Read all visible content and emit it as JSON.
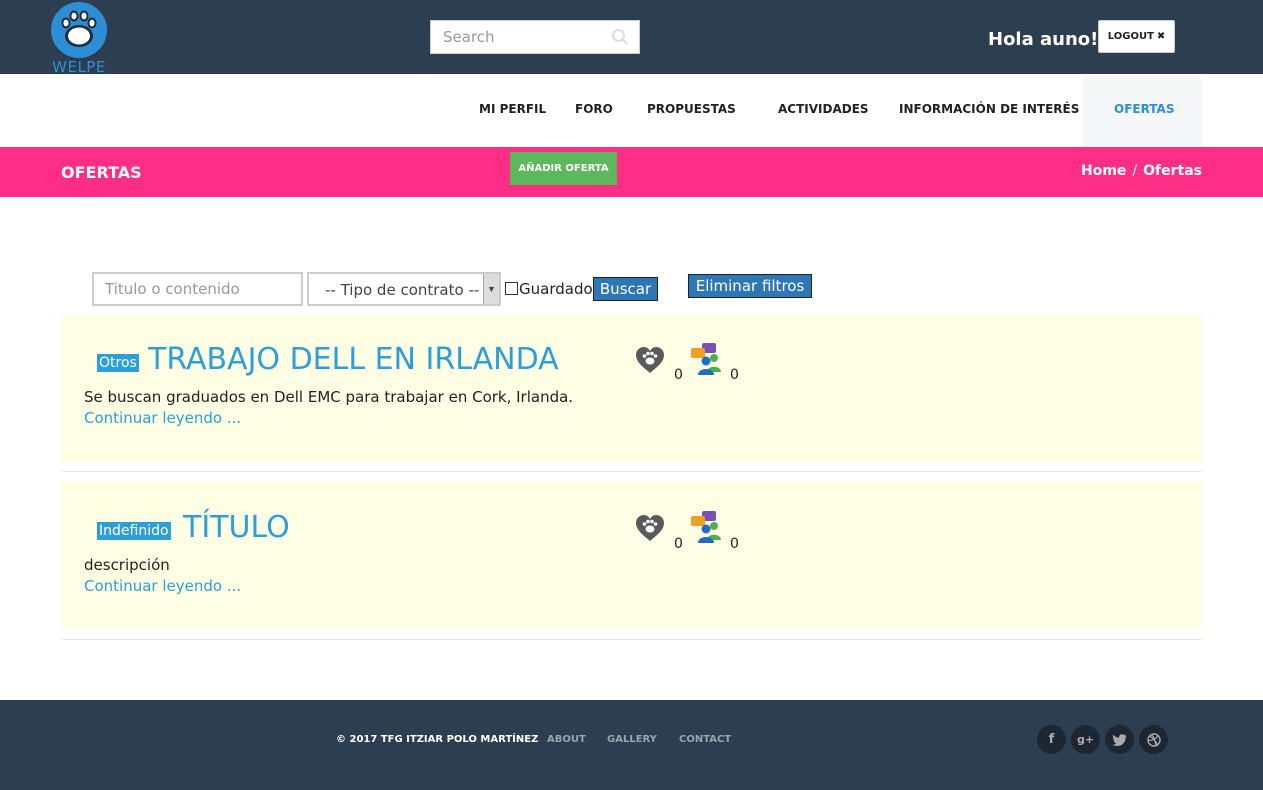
{
  "header": {
    "logo_text": "WELPE",
    "search_placeholder": "Search",
    "greeting": "Hola auno!",
    "logout_label": "LOGOUT"
  },
  "nav": {
    "items": [
      "MI PERFIL",
      "FORO",
      "PROPUESTAS",
      "ACTIVIDADES",
      "INFORMACIÓN DE INTERÉS",
      "OFERTAS"
    ],
    "active": "OFERTAS"
  },
  "page": {
    "title": "OFERTAS",
    "add_button": "AÑADIR OFERTA",
    "breadcrumb_home": "Home",
    "breadcrumb_sep": "/",
    "breadcrumb_current": "Ofertas"
  },
  "filters": {
    "text_placeholder": "Titulo o contenido",
    "contract_selected": "-- Tipo de contrato --",
    "saved_label": "Guardado",
    "search_button": "Buscar",
    "clear_button": "Eliminar filtros"
  },
  "offers": [
    {
      "tag": "Otros",
      "title": "TRABAJO DELL EN IRLANDA",
      "description": "Se buscan graduados en Dell EMC para trabajar en Cork, Irlanda.",
      "read_more": "Continuar leyendo ...",
      "likes": "0",
      "comments": "0"
    },
    {
      "tag": "Indefinido",
      "title": "TÍTULO",
      "description": "descripción",
      "read_more": "Continuar leyendo ...",
      "likes": "0",
      "comments": "0"
    }
  ],
  "footer": {
    "copyright": "© 2017 TFG ITZIAR POLO MARTÍNEZ",
    "links": [
      "ABOUT",
      "GALLERY",
      "CONTACT"
    ],
    "social": [
      "facebook-icon",
      "google-plus-icon",
      "twitter-icon",
      "dribbble-icon"
    ]
  },
  "colors": {
    "topbar": "#2d3e50",
    "accent_blue": "#2c8fd6",
    "pink": "#fe2e86",
    "green": "#5cb85c",
    "card_bg": "#fdfee4"
  }
}
